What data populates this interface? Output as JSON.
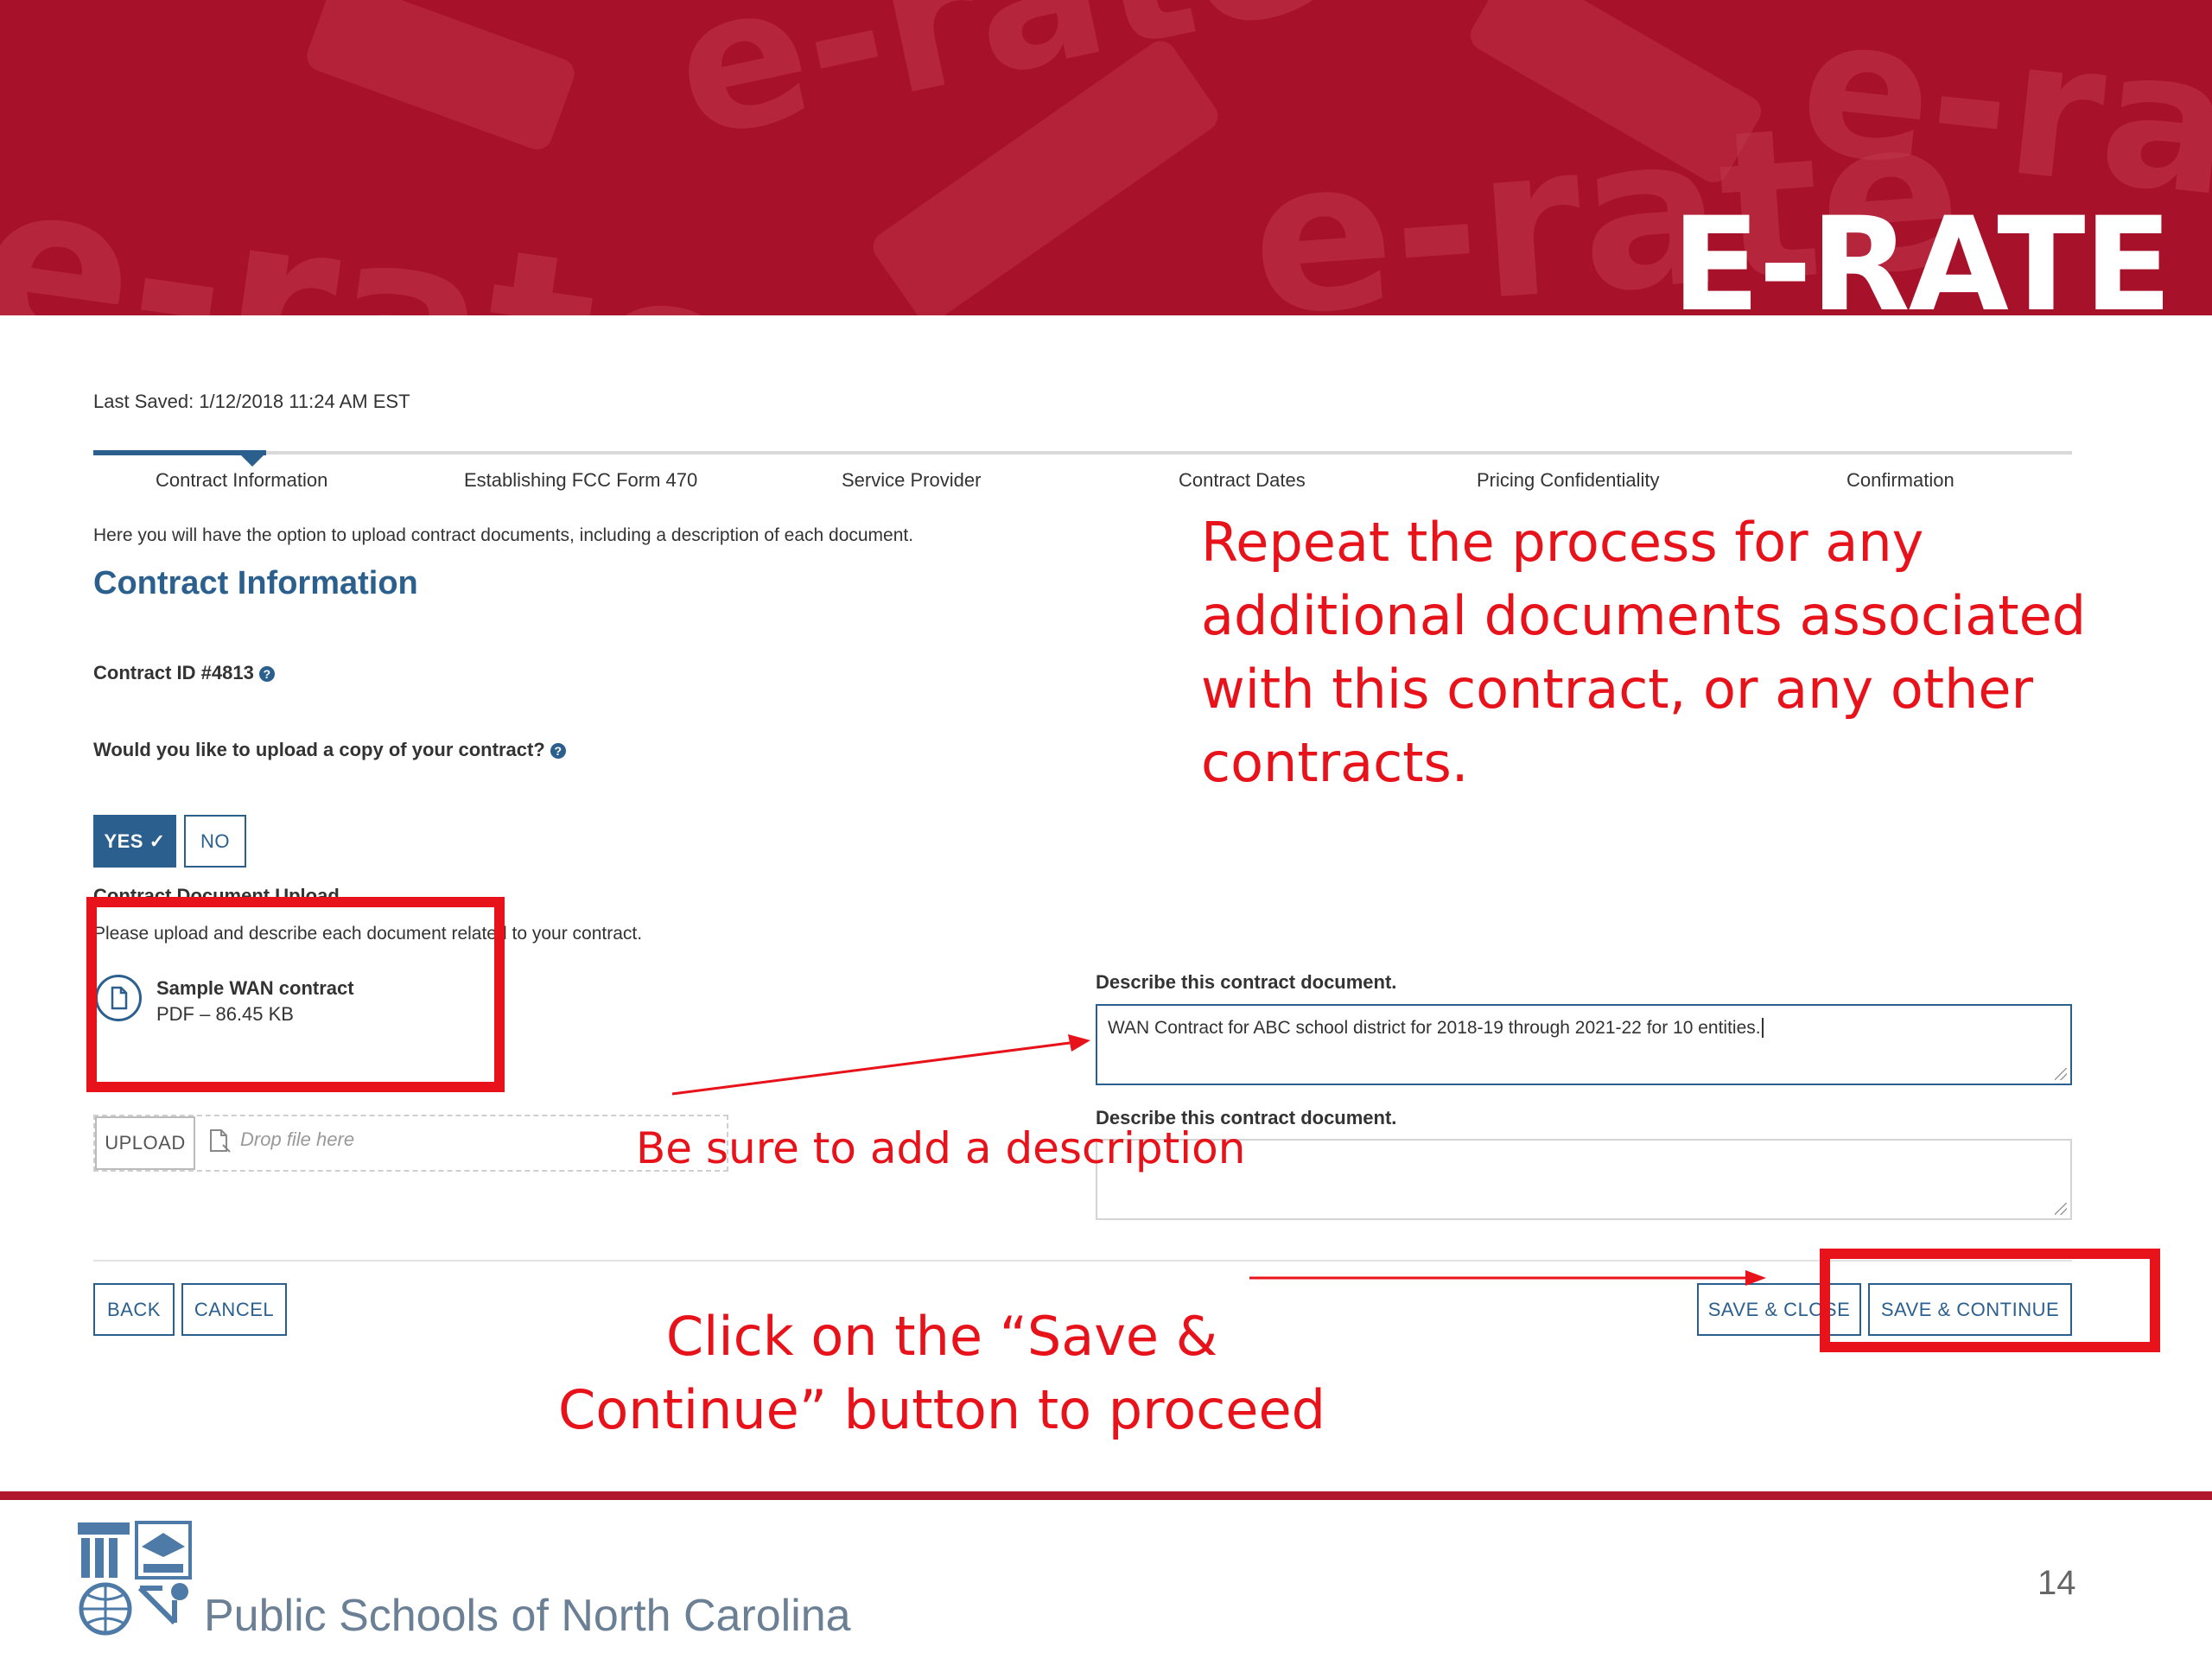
{
  "banner": {
    "title": "E-RATE",
    "watermark_text": "e-rate",
    "color": "#a8112a"
  },
  "form": {
    "last_saved": "Last Saved: 1/12/2018 11:24 AM EST",
    "steps": [
      {
        "label": "Contract Information",
        "active": true
      },
      {
        "label": "Establishing FCC Form 470",
        "active": false
      },
      {
        "label": "Service Provider",
        "active": false
      },
      {
        "label": "Contract Dates",
        "active": false
      },
      {
        "label": "Pricing Confidentiality",
        "active": false
      },
      {
        "label": "Confirmation",
        "active": false
      }
    ],
    "intro": "Here you will have the option to upload contract documents, including a description of each document.",
    "section_title": "Contract Information",
    "contract_id_label": "Contract ID #4813",
    "upload_question": "Would you like to upload a copy of your contract?",
    "yes_label": "YES ✓",
    "no_label": "NO",
    "upload_heading": "Contract Document Upload",
    "upload_instructions": "Please upload and describe each document related to your contract.",
    "file": {
      "name": "Sample WAN contract",
      "meta": "PDF – 86.45 KB",
      "icon": "document-icon"
    },
    "upload_button": "UPLOAD",
    "drop_text": "Drop file here",
    "describe_label_1": "Describe this contract document.",
    "describe_value_1": "WAN Contract for ABC school district for 2018-19 through 2021-22 for 10 entities.",
    "describe_label_2": "Describe this contract document.",
    "describe_value_2": "",
    "buttons": {
      "back": "BACK",
      "cancel": "CANCEL",
      "save_close": "SAVE & CLOSE",
      "save_continue": "SAVE & CONTINUE"
    },
    "accent_color": "#2b5f8e"
  },
  "annotations": {
    "repeat_note": "Repeat the process for any additional documents associated with this contract, or any other contracts.",
    "description_note": "Be sure to add a description",
    "continue_note": "Click on the “Save & Continue” button to proceed",
    "color": "#e8121b"
  },
  "footer": {
    "org_name": "Public Schools of North Carolina",
    "page_number": "14"
  }
}
